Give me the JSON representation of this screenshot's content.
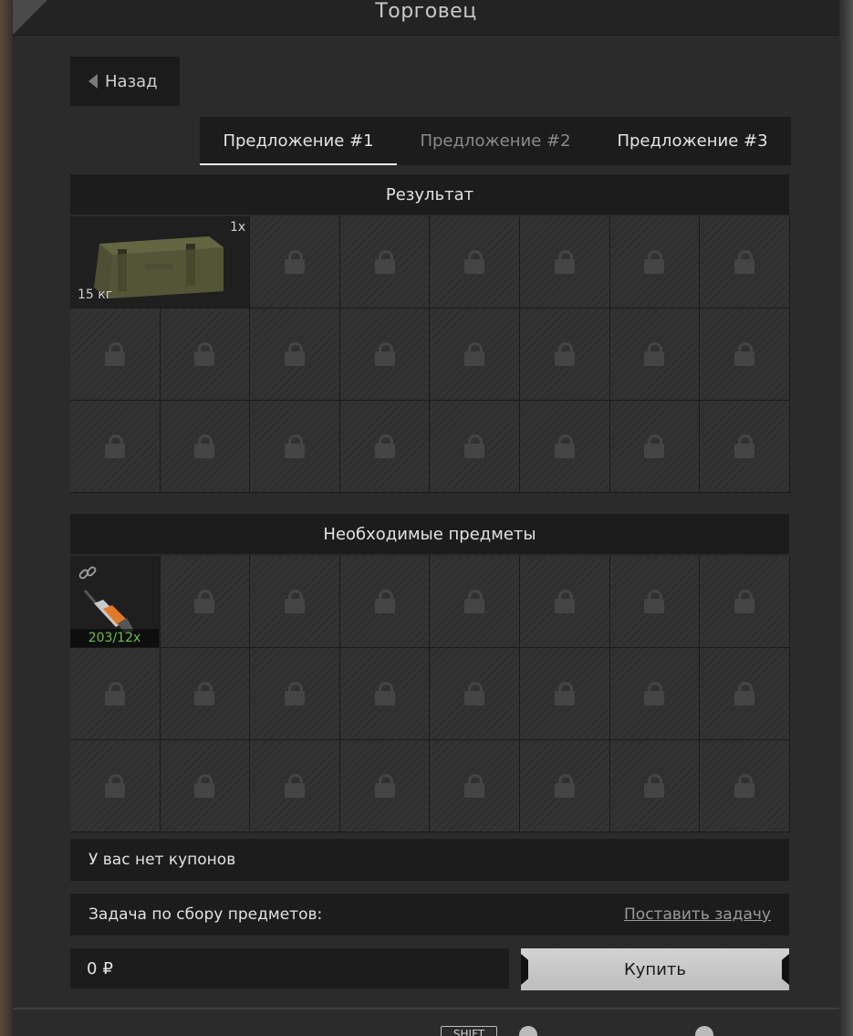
{
  "window": {
    "title": "Торговец"
  },
  "nav": {
    "back_label": "Назад"
  },
  "tabs": [
    {
      "label": "Предложение #1",
      "active": true
    },
    {
      "label": "Предложение #2",
      "active": false
    },
    {
      "label": "Предложение #3",
      "active": false
    }
  ],
  "result": {
    "header": "Результат",
    "item": {
      "icon": "ammo-crate-icon",
      "quantity": "1x",
      "weight": "15 кг"
    }
  },
  "required": {
    "header": "Необходимые предметы",
    "item": {
      "icon": "tracer-round-icon",
      "link_icon": "link-icon",
      "count": "203/12x"
    }
  },
  "coupons": {
    "text": "У вас нет купонов"
  },
  "task": {
    "label": "Задача по сбору предметов:",
    "link": "Поставить задачу"
  },
  "purchase": {
    "price": "0",
    "currency": "₽",
    "buy_label": "Купить"
  },
  "footer": {
    "shift_key": "SHIFT"
  },
  "colors": {
    "count_ok": "#6fbf4a",
    "panel_bg": "#2b2b2b",
    "bar_bg": "#1c1c1c"
  }
}
